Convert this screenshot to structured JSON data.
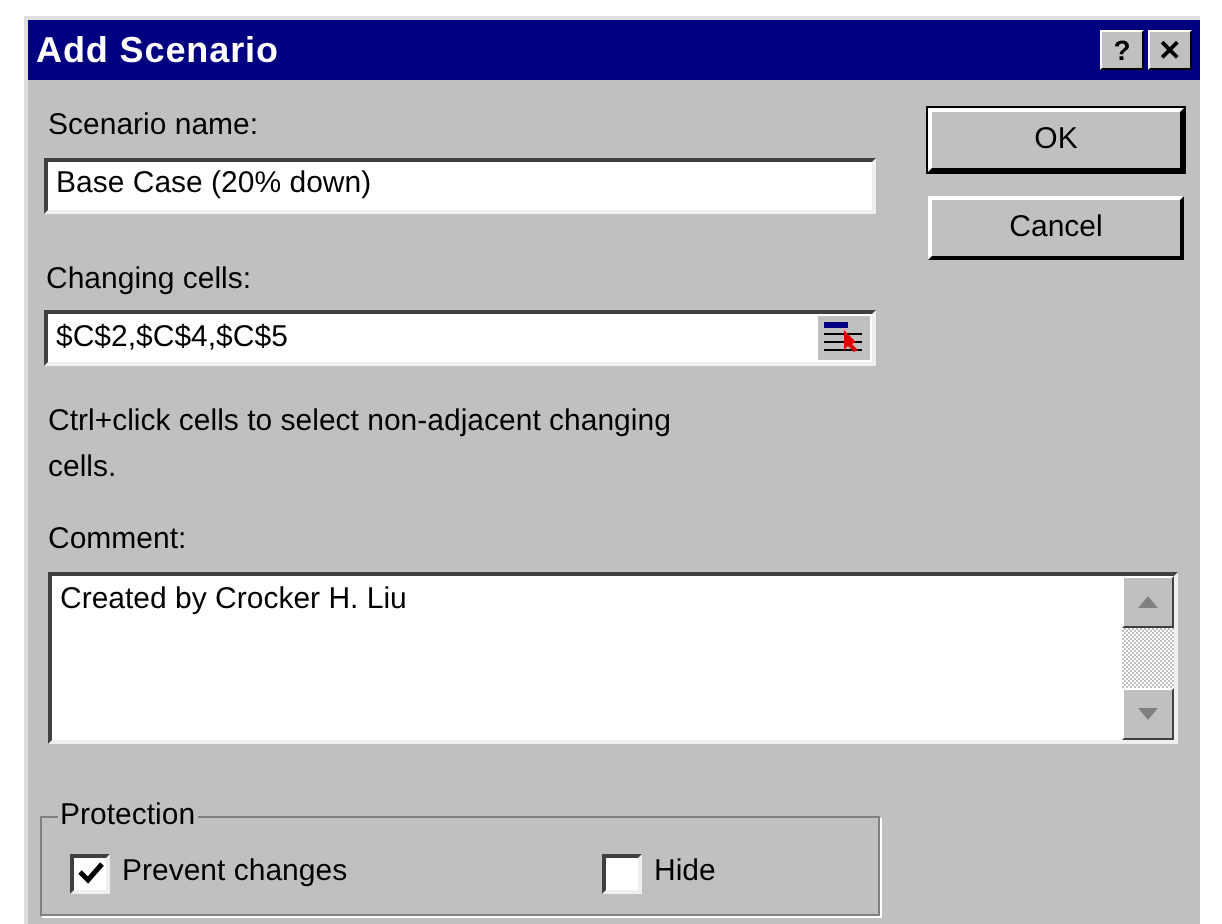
{
  "window": {
    "title": "Add Scenario",
    "title_buttons": [
      "?",
      "✕"
    ]
  },
  "scenario_name": {
    "label": "Scenario name:",
    "value": "Base Case (20% down)"
  },
  "changing_cells": {
    "label": "Changing cells:",
    "value": "$C$2,$C$4,$C$5"
  },
  "hint": "Ctrl+click cells to select non-adjacent changing cells.",
  "comment": {
    "label": "Comment:",
    "value": "Created by Crocker H. Liu"
  },
  "buttons": [
    "OK",
    "Cancel"
  ],
  "protection": {
    "title": "Protection",
    "options": [
      {
        "label": "Prevent changes",
        "checked": true
      },
      {
        "label": "Hide",
        "checked": false
      }
    ]
  }
}
